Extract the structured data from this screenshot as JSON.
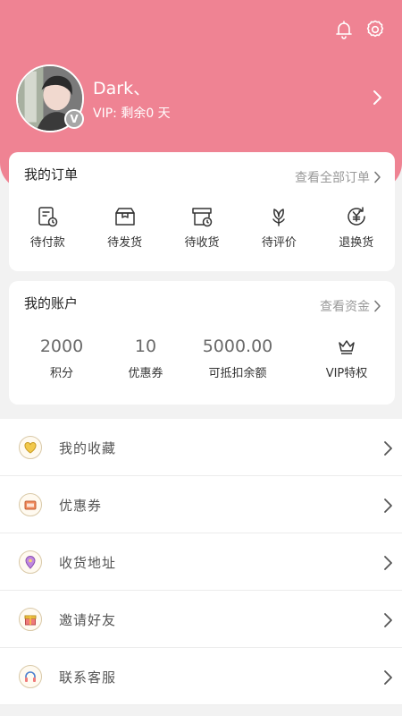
{
  "header": {
    "bell_icon": "bell-icon",
    "settings_icon": "gear-icon",
    "username": "Dark、",
    "vip_info": "VIP: 剩余0 天",
    "vip_badge": "V",
    "accent_color": "#ef8393"
  },
  "orders": {
    "title": "我的订单",
    "view_all": "查看全部订单",
    "items": [
      {
        "label": "待付款",
        "icon": "pending-payment-icon"
      },
      {
        "label": "待发货",
        "icon": "pending-shipment-icon"
      },
      {
        "label": "待收货",
        "icon": "pending-receipt-icon"
      },
      {
        "label": "待评价",
        "icon": "pending-review-icon"
      },
      {
        "label": "退换货",
        "icon": "refund-icon"
      }
    ]
  },
  "account": {
    "title": "我的账户",
    "view_funds": "查看资金",
    "items": [
      {
        "value": "2000",
        "label": "积分"
      },
      {
        "value": "10",
        "label": "优惠券"
      },
      {
        "value": "5000.00",
        "label": "可抵扣余额"
      },
      {
        "value": "",
        "label": "VIP特权",
        "icon": "crown-icon"
      }
    ]
  },
  "menu": [
    {
      "label": "我的收藏",
      "icon": "heart-icon",
      "color": "#e8b93c"
    },
    {
      "label": "优惠券",
      "icon": "coupon-icon",
      "color": "#e67b52"
    },
    {
      "label": "收货地址",
      "icon": "location-icon",
      "color": "#b77bd6"
    },
    {
      "label": "邀请好友",
      "icon": "gift-icon",
      "color": "#ef6a6a"
    },
    {
      "label": "联系客服",
      "icon": "headset-icon",
      "color": "#5a8fdc"
    }
  ]
}
